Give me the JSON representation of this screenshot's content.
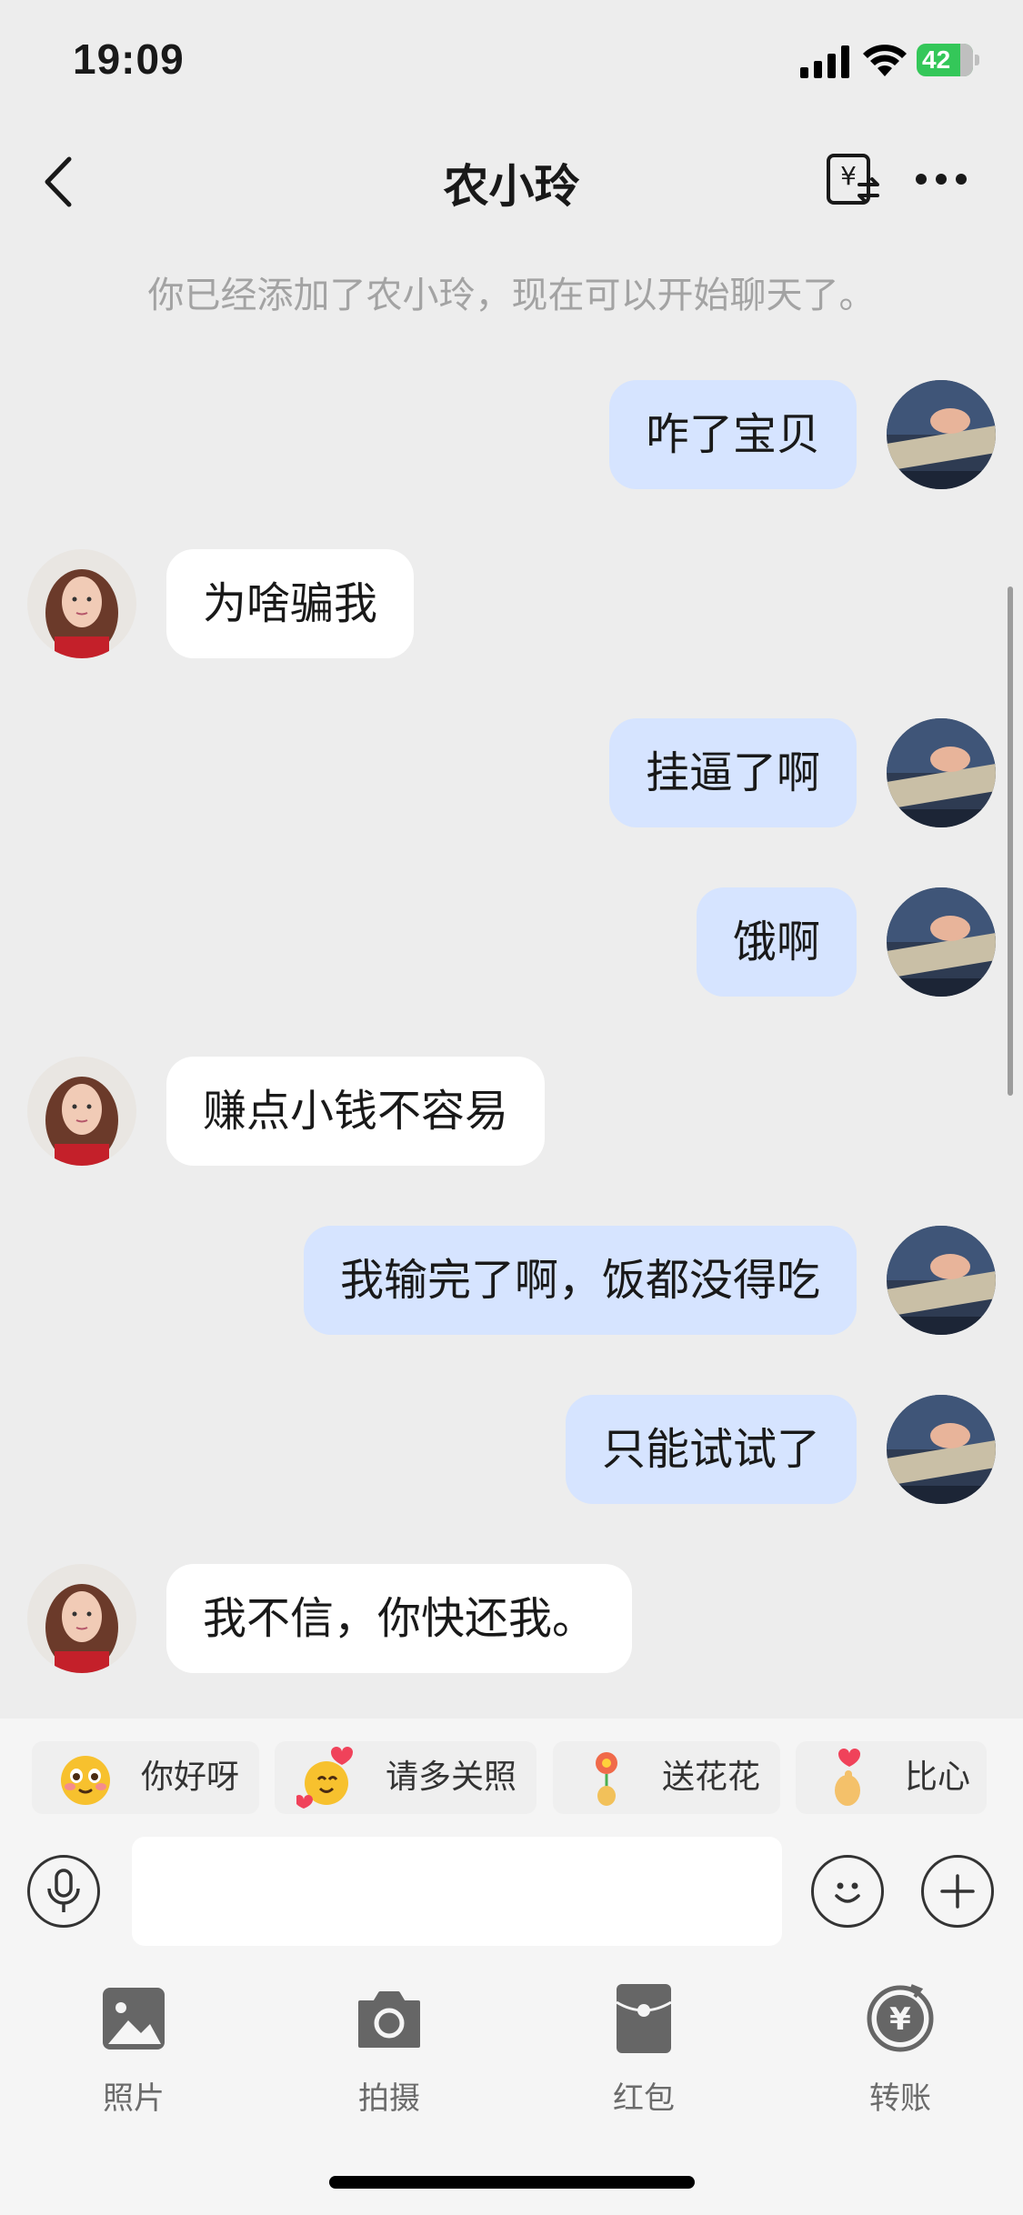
{
  "status_bar": {
    "time": "19:09",
    "battery": "42"
  },
  "nav": {
    "title": "农小玲"
  },
  "system_note": "你已经添加了农小玲，现在可以开始聊天了。",
  "messages": [
    {
      "dir": "out",
      "text": "咋了宝贝"
    },
    {
      "dir": "in",
      "text": "为啥骗我"
    },
    {
      "dir": "out",
      "text": "挂逼了啊"
    },
    {
      "dir": "out",
      "text": "饿啊"
    },
    {
      "dir": "in",
      "text": "赚点小钱不容易"
    },
    {
      "dir": "out",
      "text": "我输完了啊，饭都没得吃"
    },
    {
      "dir": "out",
      "text": "只能试试了"
    },
    {
      "dir": "in",
      "text": "我不信，你快还我。"
    }
  ],
  "quick_replies": [
    {
      "label": "你好呀",
      "icon": "blushing-face-icon"
    },
    {
      "label": "请多关照",
      "icon": "hugging-face-icon"
    },
    {
      "label": "送花花",
      "icon": "flower-icon"
    },
    {
      "label": "比心",
      "icon": "finger-heart-icon"
    }
  ],
  "input": {
    "placeholder": ""
  },
  "tools": [
    {
      "label": "照片",
      "icon": "photo-icon"
    },
    {
      "label": "拍摄",
      "icon": "camera-icon"
    },
    {
      "label": "红包",
      "icon": "red-packet-icon"
    },
    {
      "label": "转账",
      "icon": "transfer-icon"
    }
  ],
  "colors": {
    "background": "#EDEDED",
    "outgoing_bubble": "#D6E4FF",
    "incoming_bubble": "#FFFFFF",
    "battery": "#34C759"
  }
}
